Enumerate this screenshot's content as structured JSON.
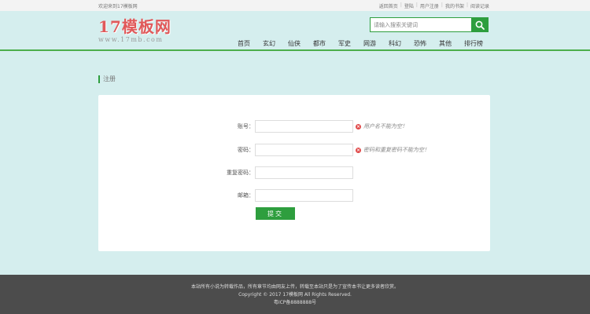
{
  "topbar": {
    "welcome": "欢迎来到17模板网",
    "links": [
      "返回首页",
      "登陆",
      "用户注册",
      "我的书架",
      "阅读记录"
    ]
  },
  "logo": {
    "main": "17模板网",
    "sub": "www.17mb.com"
  },
  "search": {
    "placeholder": "请输入搜索关键词",
    "icon": "search-icon"
  },
  "nav": [
    "首页",
    "玄幻",
    "仙侠",
    "都市",
    "军史",
    "网游",
    "科幻",
    "恐怖",
    "其他",
    "排行榜"
  ],
  "section": {
    "title": "注册"
  },
  "form": {
    "fields": [
      {
        "label": "账号：",
        "value": "",
        "error": "用户名不能为空！"
      },
      {
        "label": "密码：",
        "value": "",
        "error": "密码和重复密码不能为空！"
      },
      {
        "label": "重复密码：",
        "value": "",
        "error": ""
      },
      {
        "label": "邮箱：",
        "value": "",
        "error": ""
      }
    ],
    "submit_label": "提交"
  },
  "footer": {
    "line1": "本站所有小说为转载作品，所有章节均由网友上传，转载至本站只是为了宣传本书让更多读者欣赏。",
    "line2": "Copyright © 2017 17模板网 All Rights Reserved.",
    "line3": "粤ICP备8888888号"
  },
  "colors": {
    "accent": "#2e9e3e",
    "background": "#d5eeee",
    "error": "#e04848",
    "logo": "#e0595a",
    "footer": "#4c4c4c"
  }
}
